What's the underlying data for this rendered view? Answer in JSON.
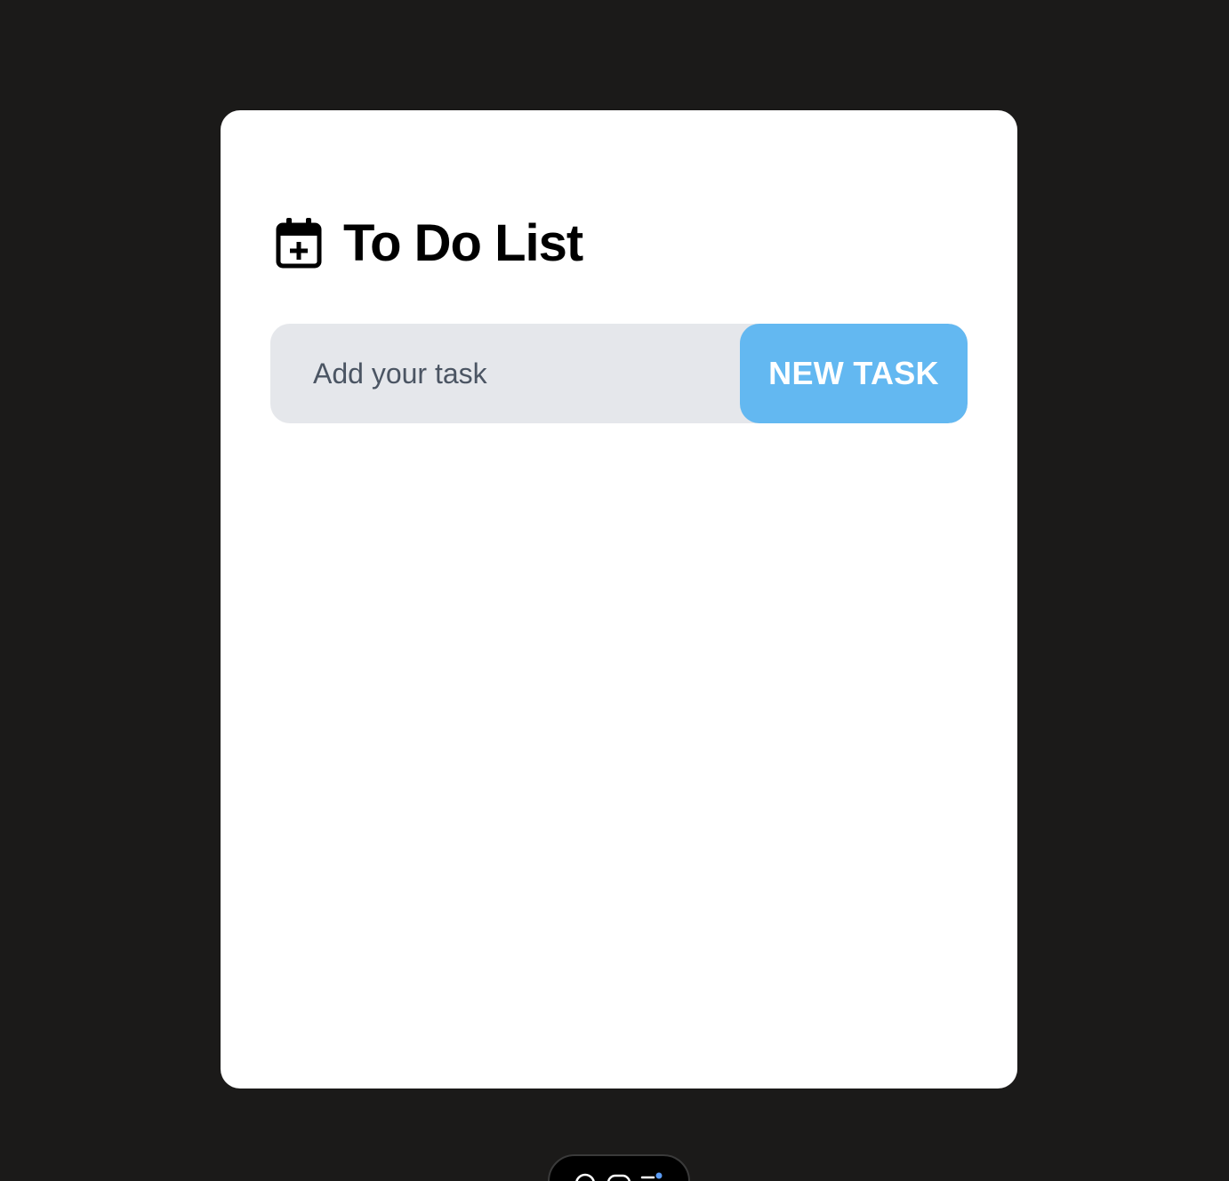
{
  "app": {
    "title": "To Do List",
    "title_icon": "calendar-plus-icon"
  },
  "task_form": {
    "input_value": "",
    "input_placeholder": "Add your task",
    "submit_label": "NEW TASK"
  },
  "tasks": [],
  "dock": {
    "icons": [
      "search-icon",
      "chat-icon",
      "list-icon"
    ]
  },
  "colors": {
    "page_background": "#1b1a19",
    "card_background": "#ffffff",
    "input_background": "#e5e7eb",
    "button_background": "#63b8f1",
    "button_text": "#ffffff",
    "title_text": "#000000",
    "placeholder_text": "#4b5563",
    "dock_notification_dot": "#5b9cf5"
  }
}
